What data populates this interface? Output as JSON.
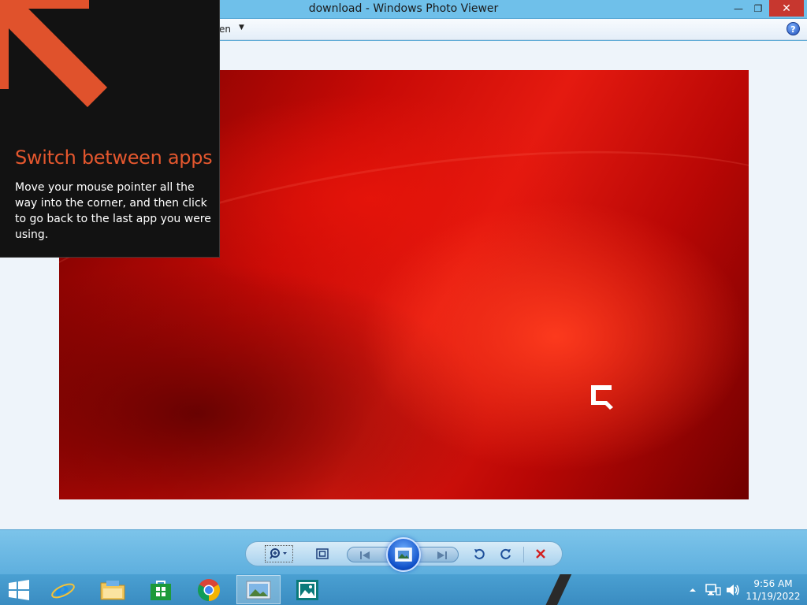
{
  "window": {
    "title": "download - Windows Photo Viewer",
    "minimize_glyph": "—",
    "maximize_glyph": "❐",
    "close_glyph": "✕"
  },
  "menubar": {
    "open_label": "en",
    "open_caret": "▼",
    "help_glyph": "?"
  },
  "tip": {
    "title": "Switch between apps",
    "body": "Move your mouse pointer all the way into the corner, and then click to go back to the last app you were using."
  },
  "toolbar": {
    "zoom_icon": "zoom-icon",
    "fit_icon": "actual-size-icon",
    "prev_icon": "previous-icon",
    "slideshow_icon": "slideshow-icon",
    "next_icon": "next-icon",
    "rotate_left_icon": "rotate-counterclockwise-icon",
    "rotate_right_icon": "rotate-clockwise-icon",
    "delete_icon": "delete-icon"
  },
  "taskbar": {
    "items": [
      {
        "name": "internet-explorer",
        "icon": "ie-icon"
      },
      {
        "name": "file-explorer",
        "icon": "folder-icon"
      },
      {
        "name": "store",
        "icon": "store-icon"
      },
      {
        "name": "chrome",
        "icon": "chrome-icon"
      },
      {
        "name": "photo-viewer",
        "icon": "photo-viewer-icon"
      },
      {
        "name": "photos-app",
        "icon": "photos-icon"
      }
    ],
    "clock_time": "9:56 AM",
    "clock_date": "11/19/2022"
  },
  "colors": {
    "tip_title": "#e4572e",
    "tip_bg": "#121212",
    "arrow": "#e0522c",
    "close_button": "#c7372f",
    "titlebar": "#6fc0ea"
  }
}
